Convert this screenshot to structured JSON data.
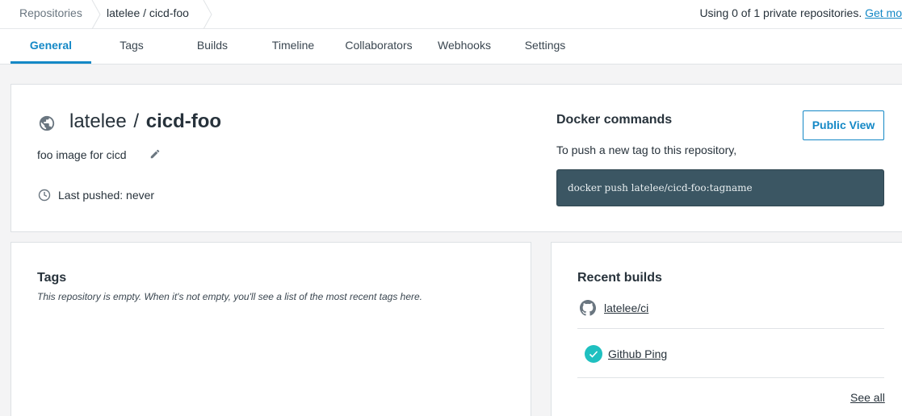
{
  "breadcrumb": {
    "repositories": "Repositories",
    "current": "latelee / cicd-foo"
  },
  "usage": {
    "text": "Using 0 of 1 private repositories.",
    "link": "Get mo"
  },
  "tabs": [
    {
      "label": "General",
      "active": true
    },
    {
      "label": "Tags"
    },
    {
      "label": "Builds"
    },
    {
      "label": "Timeline"
    },
    {
      "label": "Collaborators"
    },
    {
      "label": "Webhooks"
    },
    {
      "label": "Settings"
    }
  ],
  "repo": {
    "namespace": "latelee",
    "separator": "/",
    "name": "cicd-foo",
    "description": "foo image for cicd",
    "last_pushed": "Last pushed: never",
    "icons": {
      "visibility": "globe-icon",
      "edit": "pencil-icon",
      "time": "clock-icon"
    }
  },
  "docker": {
    "heading": "Docker commands",
    "subtitle": "To push a new tag to this repository,",
    "command": "docker push latelee/cicd-foo:tagname",
    "public_view": "Public View"
  },
  "tags_panel": {
    "heading": "Tags",
    "empty_message": "This repository is empty. When it's not empty, you'll see a list of the most recent tags here."
  },
  "builds_panel": {
    "heading": "Recent builds",
    "source": "latelee/ci",
    "builds": [
      {
        "label": "Github Ping",
        "status": "success"
      }
    ],
    "see_all": "See all"
  },
  "colors": {
    "accent": "#1488c6",
    "command_bg": "#3b5663",
    "success": "#1fc0c0"
  }
}
